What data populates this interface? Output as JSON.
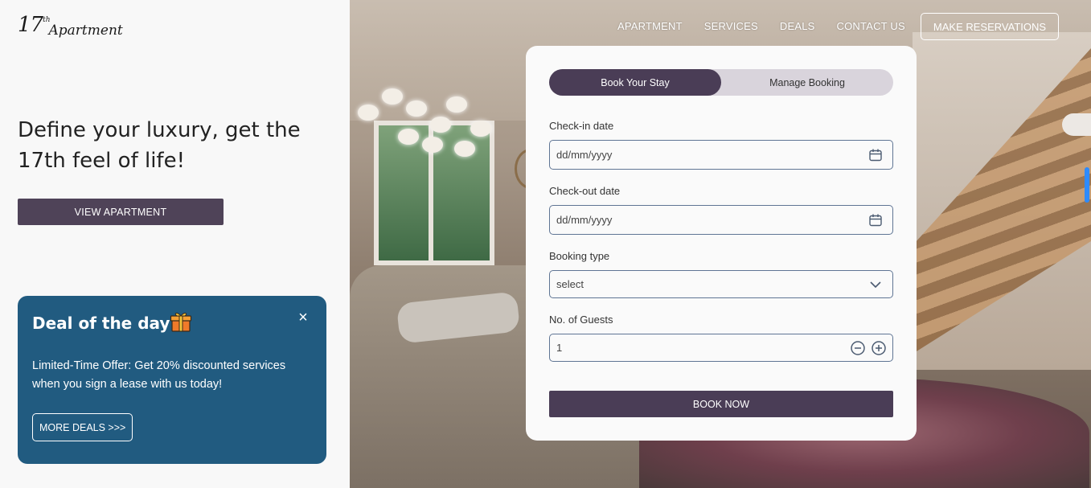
{
  "brand": {
    "logo_num": "17",
    "logo_sup": "th",
    "logo_word": "Apartment"
  },
  "hero": {
    "title": "Define your luxury, get the 17th feel of life!",
    "cta_label": "VIEW APARTMENT"
  },
  "deal": {
    "title": "Deal of the day!",
    "text": "Limited-Time Offer: Get 20% discounted services when you sign a lease with us today!",
    "button_label": "MORE DEALS >>>",
    "close_glyph": "×",
    "background": "#215b80"
  },
  "nav": {
    "items": [
      "APARTMENT",
      "SERVICES",
      "DEALS",
      "CONTACT US"
    ],
    "reserve_label": "MAKE RESERVATIONS"
  },
  "booking": {
    "tabs": [
      {
        "label": "Book Your Stay",
        "active": true
      },
      {
        "label": "Manage Booking",
        "active": false
      }
    ],
    "checkin": {
      "label": "Check-in date",
      "placeholder": "dd/mm/yyyy",
      "icon": "calendar-icon"
    },
    "checkout": {
      "label": "Check-out date",
      "placeholder": "dd/mm/yyyy",
      "icon": "calendar-icon"
    },
    "type": {
      "label": "Booking type",
      "value": "select",
      "icon": "chevron-down-icon"
    },
    "guests": {
      "label": "No. of Guests",
      "value": "1"
    },
    "submit_label": "BOOK NOW"
  },
  "colors": {
    "primary": "#4a3d56",
    "accent": "#215b80",
    "field_border": "#5f7594"
  }
}
